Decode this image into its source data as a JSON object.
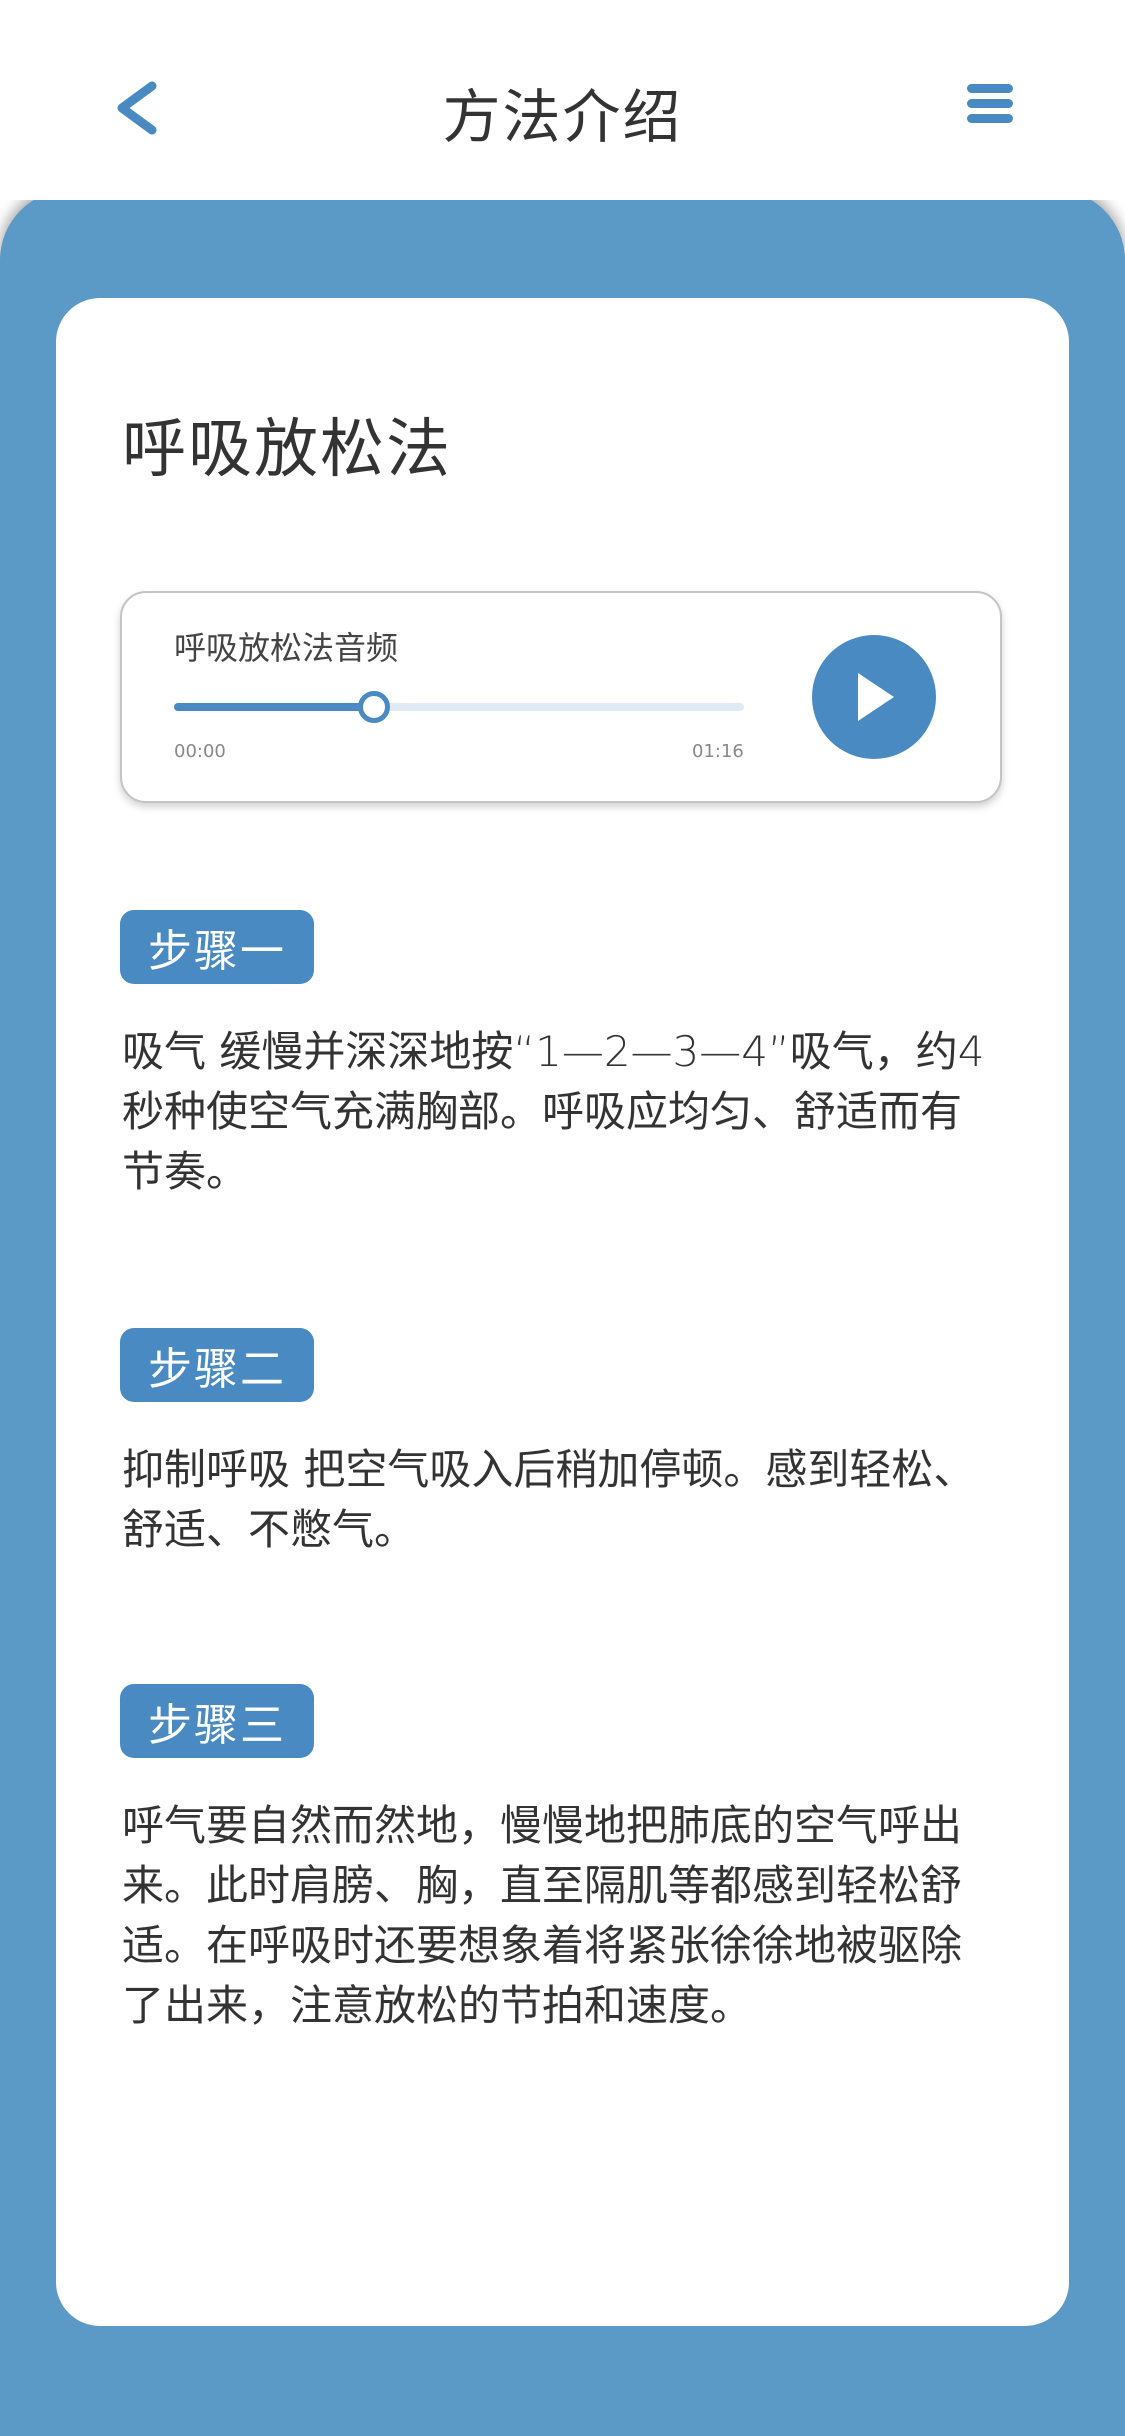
{
  "header": {
    "title": "方法介绍",
    "back_icon": "chevron-left-icon",
    "menu_icon": "menu-icon"
  },
  "colors": {
    "accent": "#4a8ac2",
    "background_blue": "#5b99c7",
    "track": "#dfeaf6",
    "text": "#333333"
  },
  "card": {
    "title": "呼吸放松法"
  },
  "player": {
    "title": "呼吸放松法音频",
    "time_start": "00:00",
    "time_end": "01:16",
    "progress": 0.35,
    "play_icon": "play-icon"
  },
  "steps": [
    {
      "label": "步骤一",
      "text": "吸气 缓慢并深深地按“1—2—3—4”吸气，约4秒种使空气充满胸部。呼吸应均匀、舒适而有节奏。"
    },
    {
      "label": "步骤二",
      "text": "抑制呼吸 把空气吸入后稍加停顿。感到轻松、舒适、不憋气。"
    },
    {
      "label": "步骤三",
      "text": "呼气要自然而然地，慢慢地把肺底的空气呼出来。此时肩膀、胸，直至隔肌等都感到轻松舒适。在呼吸时还要想象着将紧张徐徐地被驱除了出来，注意放松的节拍和速度。"
    }
  ]
}
